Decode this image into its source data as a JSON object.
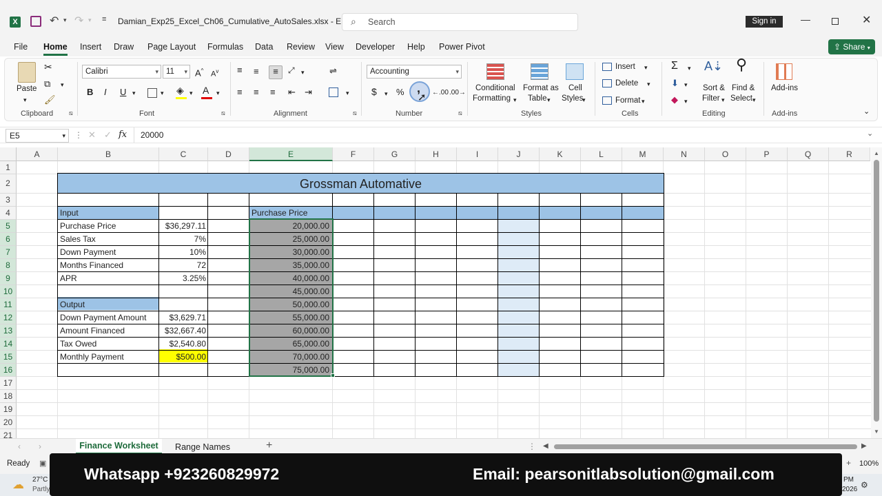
{
  "app": {
    "filename": "Damian_Exp25_Excel_Ch06_Cumulative_AutoSales.xlsx  -  E...",
    "search_placeholder": "Search",
    "sign_in": "Sign in",
    "share": "Share"
  },
  "tabs": [
    "File",
    "Home",
    "Insert",
    "Draw",
    "Page Layout",
    "Formulas",
    "Data",
    "Review",
    "View",
    "Developer",
    "Help",
    "Power Pivot"
  ],
  "ribbon": {
    "paste": "Paste",
    "clipboard": "Clipboard",
    "font_name": "Calibri",
    "font_size": "11",
    "font": "Font",
    "alignment": "Alignment",
    "number_format": "Accounting",
    "number": "Number",
    "cond_format_1": "Conditional",
    "cond_format_2": "Formatting",
    "format_table_1": "Format as",
    "format_table_2": "Table",
    "cell_styles_1": "Cell",
    "cell_styles_2": "Styles",
    "styles": "Styles",
    "insert": "Insert",
    "delete": "Delete",
    "format": "Format",
    "cells": "Cells",
    "sort_1": "Sort &",
    "sort_2": "Filter",
    "find_1": "Find &",
    "find_2": "Select",
    "editing": "Editing",
    "addins": "Add-ins",
    "addins_group": "Add-ins",
    "bold": "B",
    "italic": "I",
    "underline": "U",
    "dollar": "$",
    "percent": "%",
    "comma": ","
  },
  "formula_bar": {
    "name_box": "E5",
    "fx": "fx",
    "formula": "20000"
  },
  "columns": [
    "A",
    "B",
    "C",
    "D",
    "E",
    "F",
    "G",
    "H",
    "I",
    "J",
    "K",
    "L",
    "M",
    "N",
    "O",
    "P",
    "Q",
    "R"
  ],
  "rows": [
    "1",
    "2",
    "3",
    "4",
    "5",
    "6",
    "7",
    "8",
    "9",
    "10",
    "11",
    "12",
    "13",
    "14",
    "15",
    "16",
    "17",
    "18",
    "19",
    "20",
    "21"
  ],
  "sheet": {
    "title": "Grossman Automative",
    "input_header": "Input",
    "output_header": "Output",
    "purchase_header": "Purchase Price",
    "labels": [
      "Purchase Price",
      "Sales Tax",
      "Down Payment",
      "Months Financed",
      "APR"
    ],
    "values": [
      "$36,297.11",
      "7%",
      "10%",
      "72",
      "3.25%"
    ],
    "out_labels": [
      "Down Payment Amount",
      "Amount Financed",
      "Tax Owed",
      "Monthly Payment"
    ],
    "out_values": [
      "$3,629.71",
      "$32,667.40",
      "$2,540.80",
      "$500.00"
    ],
    "prices": [
      "20,000.00",
      "25,000.00",
      "30,000.00",
      "35,000.00",
      "40,000.00",
      "45,000.00",
      "50,000.00",
      "55,000.00",
      "60,000.00",
      "65,000.00",
      "70,000.00",
      "75,000.00"
    ]
  },
  "sheet_tabs": [
    "Finance Worksheet",
    "Range Names"
  ],
  "status": {
    "ready": "Ready",
    "zoom": "100%",
    "weather_temp": "27°C",
    "weather_desc": "Partly",
    "time": "PM",
    "year": "2026"
  },
  "banner": {
    "whatsapp": "Whatsapp +923260829972",
    "email": "Email: pearsonitlabsolution@gmail.com"
  },
  "colors": {
    "excel_green": "#217346",
    "header_blue": "#9dc3e6",
    "selection_gray": "#a6a6a6",
    "highlight_yellow": "#ffff00",
    "pale_blue": "#deebf7"
  }
}
